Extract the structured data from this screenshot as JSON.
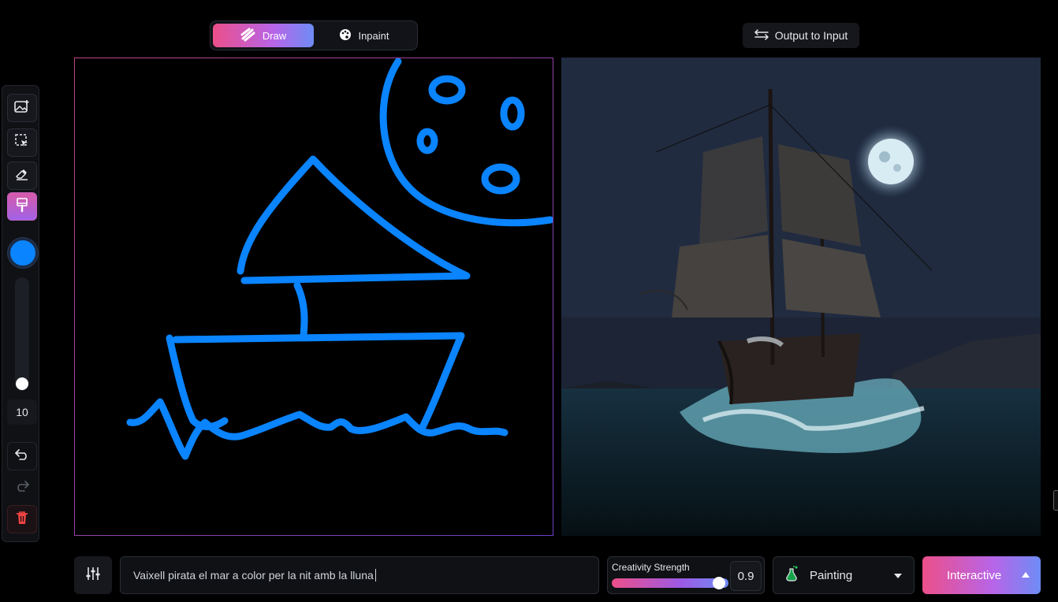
{
  "mode_toggle": {
    "draw_label": "Draw",
    "inpaint_label": "Inpaint",
    "active": "Draw"
  },
  "output_to_input_label": "Output to Input",
  "toolbar": {
    "tools": [
      "add-image",
      "select",
      "eraser",
      "brush"
    ],
    "active_tool": "brush",
    "brush_color": "#0a84ff",
    "brush_size": "10"
  },
  "prompt": {
    "value": "Vaixell pirata el mar a color per la nit amb la lluna"
  },
  "creativity": {
    "label": "Creativity Strength",
    "value": "0.9",
    "level": 0.9
  },
  "style_select": {
    "value": "Painting"
  },
  "generate_button": {
    "label": "Interactive"
  },
  "colors": {
    "accent_start": "#ec4f8a",
    "accent_end": "#6e8cf5",
    "stroke": "#0a84ff"
  }
}
